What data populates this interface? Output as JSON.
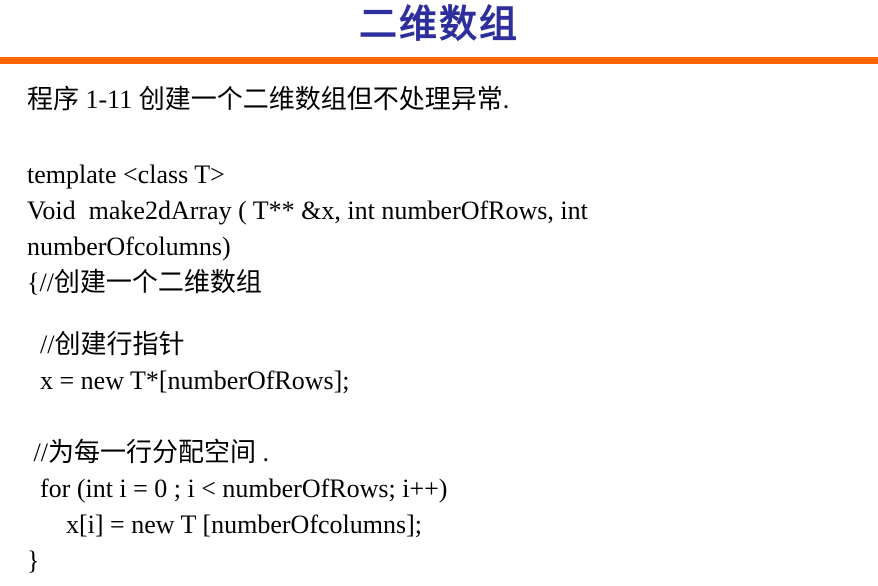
{
  "title": "二维数组",
  "colors": {
    "title": "#2e2e9c",
    "rule": "#ff6600"
  },
  "lines": [
    "程序 1-11 创建一个二维数组但不处理异常.",
    "template <class T>",
    "Void  make2dArray ( T** &x, int numberOfRows, int",
    "numberOfcolumns)",
    "{//创建一个二维数组",
    "  //创建行指针",
    "  x = new T*[numberOfRows];",
    " //为每一行分配空间 .",
    "  for (int i = 0 ; i < numberOfRows; i++)",
    "      x[i] = new T [numberOfcolumns];",
    "}"
  ]
}
